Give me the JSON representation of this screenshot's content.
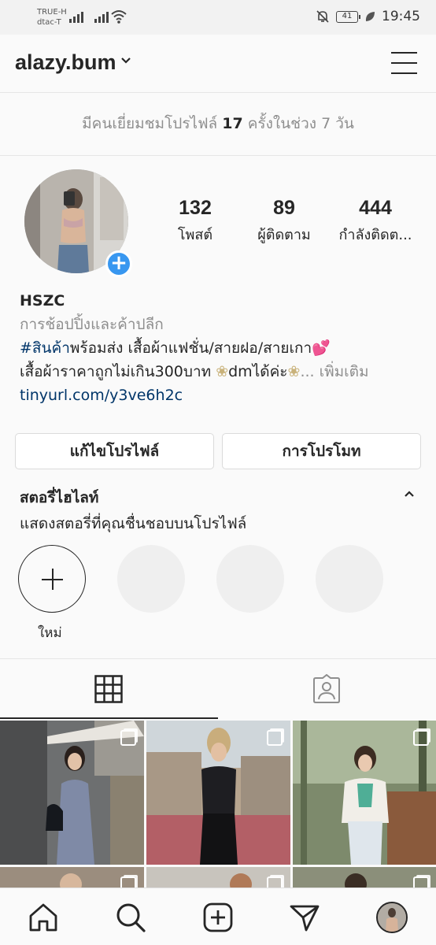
{
  "status": {
    "carrier1": "TRUE-H",
    "carrier2": "dtac-T",
    "battery": "41",
    "time": "19:45"
  },
  "header": {
    "username": "alazy.bum"
  },
  "visits": {
    "prefix": "มีคนเยี่ยมชมโปรไฟล์ ",
    "count": "17",
    "suffix": " ครั้งในช่วง 7 วัน"
  },
  "stats": [
    {
      "value": "132",
      "label": "โพสต์"
    },
    {
      "value": "89",
      "label": "ผู้ติดตาม"
    },
    {
      "value": "444",
      "label": "กำลังติดต..."
    }
  ],
  "bio": {
    "name": "HSZC",
    "category": "การช้อปปิ้งและค้าปลีก",
    "hashtag": "#สินค้า",
    "line1_rest": "พร้อมส่ง เสื้อผ้าแฟชั่น/สายฝอ/สายเกา",
    "line1_emoji": "💕",
    "line2_text": "เสื้อผ้าราคาถูกไม่เกิน300บาท ",
    "flower": "❀",
    "line2_dm": "dmได้ค่ะ",
    "more": "... เพิ่มเติม",
    "link": "tinyurl.com/y3ve6h2c"
  },
  "buttons": {
    "edit": "แก้ไขโปรไฟล์",
    "promote": "การโปรโมท"
  },
  "highlights": {
    "title": "สตอรี่ไฮไลท์",
    "subtitle": "แสดงสตอรี่ที่คุณชื่นชอบบนโปรไฟล์",
    "new_label": "ใหม่"
  },
  "tabs": [
    "grid",
    "tagged"
  ],
  "nav": [
    "home",
    "search",
    "new-post",
    "direct",
    "profile"
  ],
  "colors": {
    "accent": "#3897f0",
    "link": "#003569",
    "muted": "#8e8e8e"
  }
}
